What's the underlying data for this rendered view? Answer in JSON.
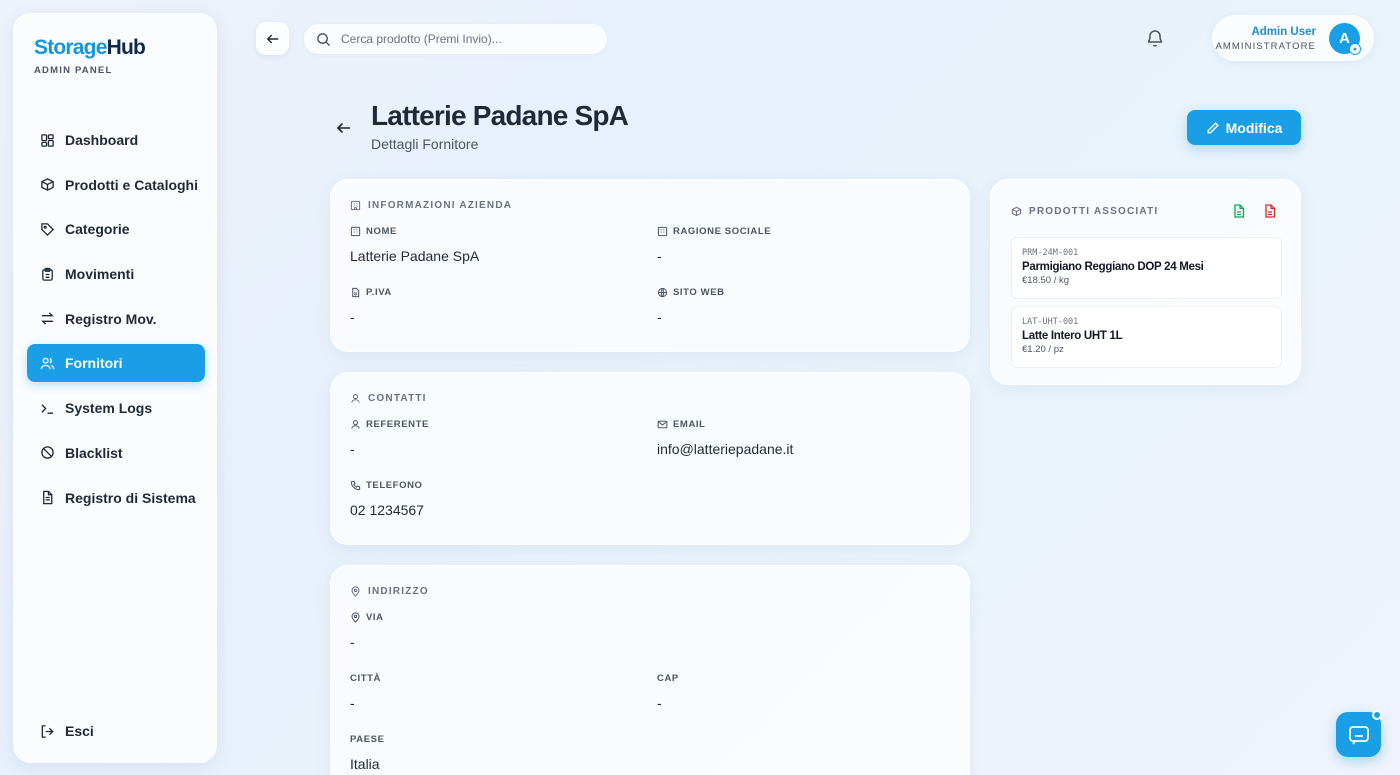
{
  "brand": {
    "part1": "Storage",
    "part2": "Hub",
    "subtitle": "ADMIN PANEL"
  },
  "sidebar": {
    "items": [
      {
        "label": "Dashboard",
        "icon": "dashboard-icon"
      },
      {
        "label": "Prodotti e Cataloghi",
        "icon": "package-icon"
      },
      {
        "label": "Categorie",
        "icon": "tag-icon"
      },
      {
        "label": "Movimenti",
        "icon": "clipboard-icon"
      },
      {
        "label": "Registro Mov.",
        "icon": "arrows-icon"
      },
      {
        "label": "Fornitori",
        "icon": "users-icon",
        "active": true
      },
      {
        "label": "System Logs",
        "icon": "terminal-icon"
      },
      {
        "label": "Blacklist",
        "icon": "ban-icon"
      },
      {
        "label": "Registro di Sistema",
        "icon": "file-text-icon"
      }
    ],
    "logout_label": "Esci"
  },
  "header": {
    "search_placeholder": "Cerca prodotto (Premi Invio)...",
    "user_name": "Admin User",
    "user_role": "AMMINISTRATORE",
    "avatar_initial": "A"
  },
  "page": {
    "title": "Latterie Padane SpA",
    "subtitle": "Dettagli Fornitore",
    "edit_label": "Modifica"
  },
  "company": {
    "heading": "INFORMAZIONI AZIENDA",
    "name_label": "NOME",
    "name_value": "Latterie Padane SpA",
    "legal_label": "RAGIONE SOCIALE",
    "legal_value": "-",
    "vat_label": "P.IVA",
    "vat_value": "-",
    "web_label": "SITO WEB",
    "web_value": "-"
  },
  "contacts": {
    "heading": "CONTATTI",
    "ref_label": "REFERENTE",
    "ref_value": "-",
    "email_label": "EMAIL",
    "email_value": "info@latteriepadane.it",
    "phone_label": "TELEFONO",
    "phone_value": "02 1234567"
  },
  "address": {
    "heading": "INDIRIZZO",
    "street_label": "VIA",
    "street_value": "-",
    "city_label": "CITTÀ",
    "city_value": "-",
    "zip_label": "CAP",
    "zip_value": "-",
    "country_label": "PAESE",
    "country_value": "Italia"
  },
  "products": {
    "heading": "PRODOTTI ASSOCIATI",
    "items": [
      {
        "code": "PRM-24M-001",
        "name": "Parmigiano Reggiano DOP 24 Mesi",
        "price": "€18.50 / kg"
      },
      {
        "code": "LAT-UHT-001",
        "name": "Latte Intero UHT 1L",
        "price": "€1.20 / pz"
      }
    ]
  },
  "colors": {
    "accent": "#1a9fe6",
    "brand_dark": "#0f2a4a",
    "excel_green": "#16a34a",
    "pdf_red": "#dc2626"
  }
}
